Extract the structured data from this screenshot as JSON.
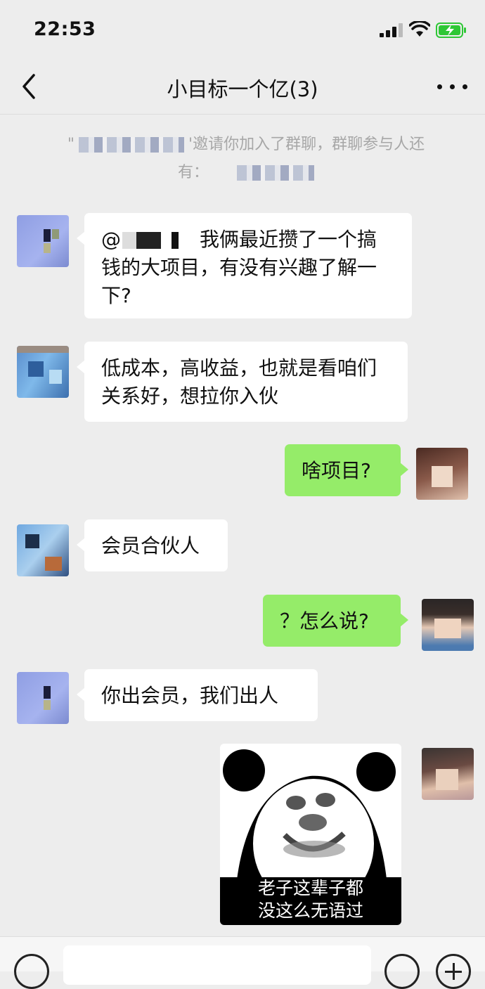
{
  "status_bar": {
    "time": "22:53"
  },
  "header": {
    "title": "小目标一个亿(3)"
  },
  "system_notice": {
    "invite_text": "'邀请你加入了群聊，群聊参与人还",
    "others_label": "有："
  },
  "messages": [
    {
      "side": "left",
      "mention": "@",
      "text": "我俩最近攒了一个搞钱的大项目，有没有兴趣了解一下?"
    },
    {
      "side": "left",
      "text": "低成本，高收益，也就是看咱们关系好，想拉你入伙"
    },
    {
      "side": "right",
      "text": "啥项目?"
    },
    {
      "side": "left",
      "text": "会员合伙人"
    },
    {
      "side": "right",
      "text": "？怎么说?"
    },
    {
      "side": "left",
      "text": "你出会员，我们出人"
    },
    {
      "side": "right",
      "type": "sticker",
      "caption_line1": "老子这辈子都",
      "caption_line2": "没这么无语过"
    }
  ],
  "icons": {
    "back": "chevron-left-icon",
    "more": "more-dots-icon",
    "voice": "voice-icon",
    "emoji": "emoji-icon",
    "add": "plus-icon"
  },
  "colors": {
    "background": "#ededed",
    "bubble_self": "#95ec69",
    "bubble_other": "#ffffff",
    "battery": "#2ec735"
  }
}
